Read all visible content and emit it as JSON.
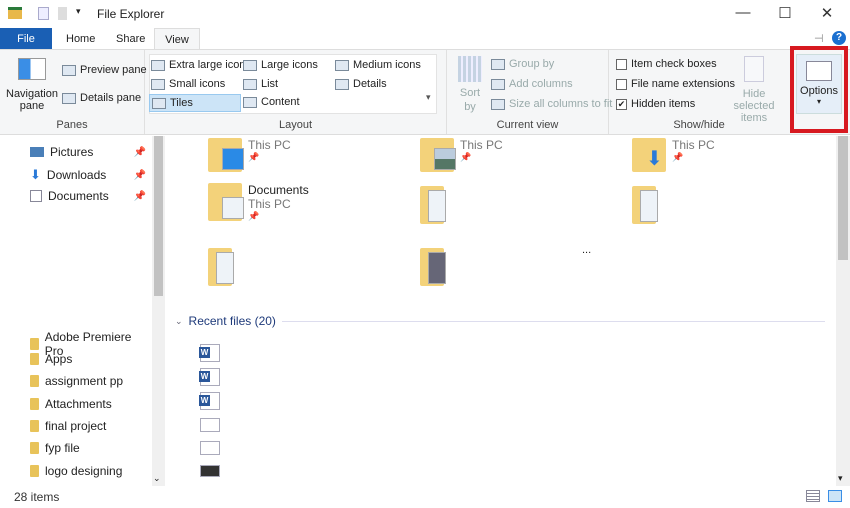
{
  "window": {
    "title": "File Explorer",
    "minimize": "—",
    "maximize": "☐",
    "close": "✕"
  },
  "tabs": [
    "File",
    "Home",
    "Share",
    "View"
  ],
  "ribbon": {
    "panes": {
      "navigation_pane": "Navigation pane",
      "preview_pane": "Preview pane",
      "details_pane": "Details pane",
      "label": "Panes"
    },
    "layout": {
      "items": [
        "Extra large icons",
        "Large icons",
        "Medium icons",
        "Small icons",
        "List",
        "Details",
        "Tiles",
        "Content"
      ],
      "selected": "Tiles",
      "label": "Layout"
    },
    "current_view": {
      "sort_by": "Sort by",
      "group_by": "Group by",
      "add_columns": "Add columns",
      "size_columns": "Size all columns to fit",
      "label": "Current view"
    },
    "show_hide": {
      "item_check_boxes": "Item check boxes",
      "file_name_extensions": "File name extensions",
      "hidden_items": "Hidden items",
      "hidden_items_checked": true,
      "hide_selected": "Hide selected items",
      "label": "Show/hide"
    },
    "options": "Options"
  },
  "nav": {
    "pinned": [
      "Pictures",
      "Downloads",
      "Documents"
    ],
    "folders": [
      "Adobe Premiere Pro",
      "Apps",
      "assignment pp",
      "Attachments",
      "final project",
      "fyp file",
      "logo designing"
    ]
  },
  "content": {
    "tiles": [
      {
        "sub": "This PC"
      },
      {
        "sub": "This PC"
      },
      {
        "sub": "This PC"
      },
      {
        "name": "Documents",
        "sub": "This PC"
      }
    ],
    "ellipsis": "...",
    "recent_header": "Recent files (20)"
  },
  "status": {
    "count": "28 items"
  },
  "colors": {
    "accent": "#1a5fb4",
    "highlight": "#d71920"
  }
}
